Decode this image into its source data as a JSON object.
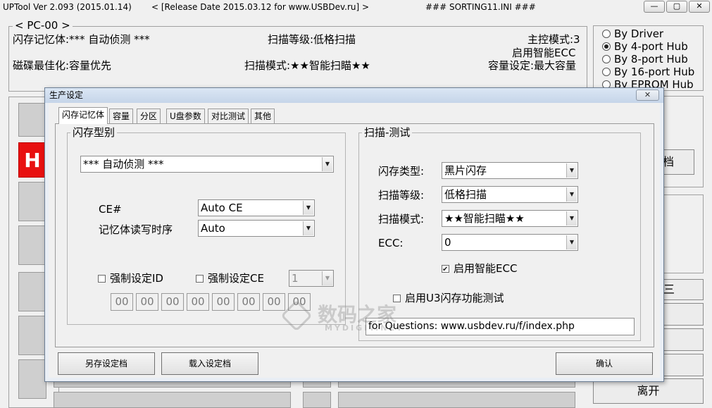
{
  "window": {
    "app_title": "UPTool Ver 2.093 (2015.01.14)",
    "release": "< [Release Date 2015.03.12 for www.USBDev.ru] >",
    "ini": "### SORTING11.INI ###",
    "min": "—",
    "max": "▢",
    "close": "✕"
  },
  "pc": {
    "legend": "< PC-00 >",
    "flash_memory": "闪存记忆体:*** 自动侦测 ***",
    "scan_level": "扫描等级:低格扫描",
    "controller_mode": "主控模式:3",
    "smart_ecc": "启用智能ECC",
    "disk_opt": "磁碟最佳化:容量优先",
    "scan_mode": "扫描模式:★★智能扫瞄★★",
    "capacity": "容量设定:最大容量"
  },
  "hub_options": {
    "items": [
      {
        "label": "By Driver",
        "selected": false
      },
      {
        "label": "By 4-port Hub",
        "selected": true
      },
      {
        "label": "By 8-port Hub",
        "selected": false
      },
      {
        "label": "By 16-port Hub",
        "selected": false
      },
      {
        "label": "By EPROM Hub",
        "selected": false
      }
    ]
  },
  "background": {
    "badge": "H",
    "doc_btn_partial": "档",
    "btn_partial": "三",
    "exit_btn": "离开"
  },
  "dialog": {
    "title": "生产设定",
    "close": "✕",
    "tabs": [
      "闪存记忆体",
      "容量",
      "分区",
      "U盘参数",
      "对比测试",
      "其他"
    ],
    "flash_group": {
      "legend": "闪存型别",
      "flash_type_value": "*** 自动侦测 ***",
      "ce_label": "CE#",
      "ce_value": "Auto CE",
      "timing_label": "记忆体读写时序",
      "timing_value": "Auto",
      "force_id_label": "强制设定ID",
      "force_ce_label": "强制设定CE",
      "force_ce_value": "1",
      "id_bytes": [
        "00",
        "00",
        "00",
        "00",
        "00",
        "00",
        "00",
        "00"
      ]
    },
    "scan_group": {
      "legend": "扫描-测试",
      "flash_kind_label": "闪存类型:",
      "flash_kind_value": "黑片闪存",
      "scan_level_label": "扫描等级:",
      "scan_level_value": "低格扫描",
      "scan_mode_label": "扫描模式:",
      "scan_mode_value": "★★智能扫瞄★★",
      "ecc_label": "ECC:",
      "ecc_value": "0",
      "smart_ecc_label": "启用智能ECC",
      "smart_ecc_checked": true,
      "u3_label": "启用U3闪存功能测试",
      "u3_checked": false
    },
    "questions_url": "for Questions: www.usbdev.ru/f/index.php",
    "buttons": {
      "save_as": "另存设定档",
      "load": "载入设定档",
      "ok": "确认"
    }
  },
  "watermark": {
    "text": "数码之家",
    "sub": "MYDIGIT.NET"
  }
}
